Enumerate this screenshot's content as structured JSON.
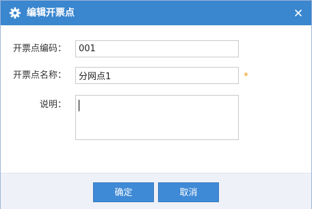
{
  "dialog": {
    "title": "编辑开票点",
    "icons": {
      "title": "gear-icon",
      "close": "close-icon"
    }
  },
  "form": {
    "code": {
      "label": "开票点编码：",
      "value": "001"
    },
    "name": {
      "label": "开票点名称：",
      "value": "分网点1",
      "required_mark": "*"
    },
    "description": {
      "label": "说明：",
      "value": ""
    }
  },
  "footer": {
    "ok_label": "确定",
    "cancel_label": "取消"
  },
  "colors": {
    "titlebar": "#3a86cf",
    "button": "#3f8ad6",
    "required": "#f39c12",
    "footer_bg": "#eef1f7"
  }
}
